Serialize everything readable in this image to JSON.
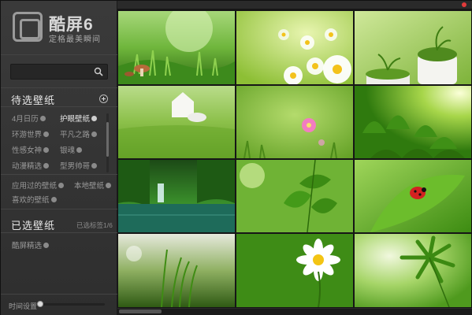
{
  "app": {
    "name": "酷屏6",
    "slogan": "定格最美瞬间"
  },
  "search": {
    "value": "",
    "placeholder": ""
  },
  "pending": {
    "title": "待选壁纸",
    "categories": [
      {
        "label": "4月日历",
        "active": false
      },
      {
        "label": "护眼壁纸",
        "active": true
      },
      {
        "label": "环游世界",
        "active": false
      },
      {
        "label": "平凡之路",
        "active": false
      },
      {
        "label": "性感女神",
        "active": false
      },
      {
        "label": "银魂",
        "active": false
      },
      {
        "label": "动漫精选",
        "active": false
      },
      {
        "label": "型男帅哥",
        "active": false
      }
    ],
    "links": [
      {
        "label": "应用过的壁纸"
      },
      {
        "label": "本地壁纸"
      },
      {
        "label": "喜欢的壁纸"
      }
    ]
  },
  "selected": {
    "title": "已选壁纸",
    "count_text": "已选标签1/6",
    "items": [
      {
        "label": "酷屏精选"
      }
    ]
  },
  "footer": {
    "time_label": "时间设置",
    "interval_fraction": 0.0
  },
  "wallpapers": [
    {
      "name": "mushrooms-grass"
    },
    {
      "name": "white-daisies"
    },
    {
      "name": "potted-seedlings"
    },
    {
      "name": "house-on-grass"
    },
    {
      "name": "pink-flower-meadow"
    },
    {
      "name": "tea-sprouts-sunlight"
    },
    {
      "name": "forest-waterfall"
    },
    {
      "name": "green-leaves-closeup"
    },
    {
      "name": "ladybug-on-leaf"
    },
    {
      "name": "grass-blades-bokeh"
    },
    {
      "name": "single-daisy"
    },
    {
      "name": "fern-leaves"
    }
  ],
  "colors": {
    "accent_close": "#e23b3b",
    "sidebar_bg": "#353535"
  }
}
